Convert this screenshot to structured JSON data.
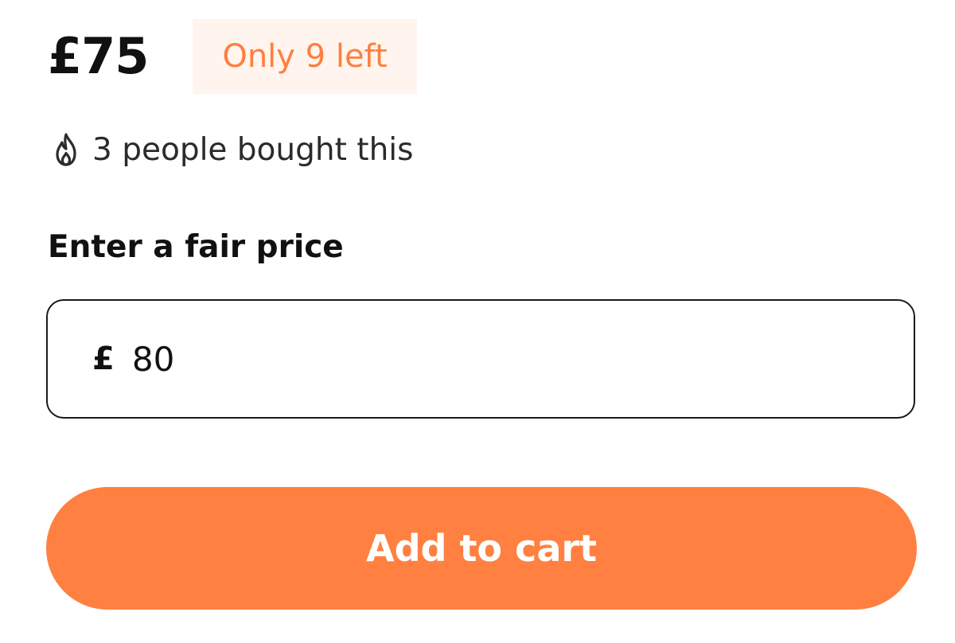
{
  "product": {
    "price": "£75",
    "stock_badge": "Only 9 left",
    "bought_count_text": "3 people bought this",
    "bought_icon": "flame-icon"
  },
  "fair_price": {
    "label": "Enter a fair price",
    "currency_symbol": "£",
    "value": "80"
  },
  "cart": {
    "button_label": "Add to cart"
  },
  "colors": {
    "accent": "#ff8040",
    "badge_background": "#fff5ee",
    "badge_text": "#ff7f3f"
  }
}
